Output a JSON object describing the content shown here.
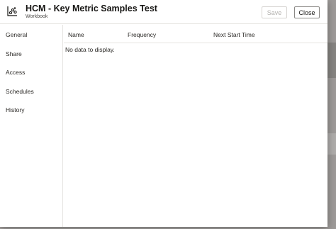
{
  "dialog": {
    "title": "HCM - Key Metric Samples Test",
    "subtitle": "Workbook",
    "icon": "workbook-icon",
    "buttons": {
      "save": "Save",
      "close": "Close"
    }
  },
  "sidebar": {
    "items": [
      {
        "label": "General"
      },
      {
        "label": "Share"
      },
      {
        "label": "Access"
      },
      {
        "label": "Schedules"
      },
      {
        "label": "History"
      }
    ]
  },
  "table": {
    "columns": [
      "Name",
      "Frequency",
      "Next Start Time"
    ],
    "empty_message": "No data to display."
  },
  "colors": {
    "scrim": "#8f8d8a",
    "dialog_bg": "#ffffff",
    "divider": "#e6e4e1",
    "disabled_text": "#b2b0ad"
  }
}
